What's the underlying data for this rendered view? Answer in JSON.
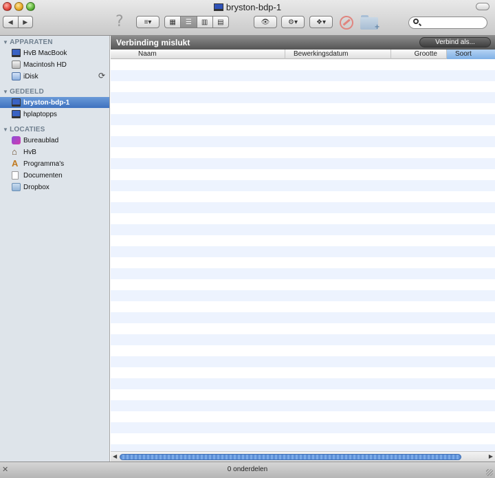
{
  "window": {
    "title": "bryston-bdp-1"
  },
  "toolbar": {
    "back_glyph": "◀",
    "forward_glyph": "▶",
    "help_glyph": "?",
    "arrange_glyph": "≡▾",
    "view_icon_glyph": "▦",
    "view_list_glyph": "☰",
    "view_column_glyph": "▥",
    "view_coverflow_glyph": "▤",
    "quicklook_glyph": "👁",
    "action_glyph": "⚙▾",
    "dropbox_glyph": "❖▾",
    "search_placeholder": ""
  },
  "sidebar": {
    "sections": [
      {
        "title": "APPARATEN"
      },
      {
        "title": "GEDEELD"
      },
      {
        "title": "LOCATIES"
      }
    ],
    "devices": [
      {
        "label": "HvB MacBook",
        "icon": "laptop-icon"
      },
      {
        "label": "Macintosh HD",
        "icon": "hard-disk-icon"
      },
      {
        "label": "iDisk",
        "icon": "idisk-icon",
        "sync_glyph": "⟳"
      }
    ],
    "shared": [
      {
        "label": "bryston-bdp-1",
        "icon": "network-computer-icon",
        "selected": true
      },
      {
        "label": "hplaptopps",
        "icon": "network-computer-icon",
        "selected": false
      }
    ],
    "places": [
      {
        "label": "Bureaublad",
        "icon": "desktop-icon"
      },
      {
        "label": "HvB",
        "icon": "home-icon"
      },
      {
        "label": "Programma's",
        "icon": "applications-icon"
      },
      {
        "label": "Documenten",
        "icon": "documents-icon"
      },
      {
        "label": "Dropbox",
        "icon": "dropbox-folder-icon"
      }
    ]
  },
  "main": {
    "banner": {
      "message": "Verbinding mislukt",
      "button_label": "Verbind als..."
    },
    "columns": [
      {
        "label": "Naam"
      },
      {
        "label": "Bewerkingsdatum"
      },
      {
        "label": "Grootte"
      },
      {
        "label": "Soort",
        "sorted": true
      }
    ],
    "rows": []
  },
  "status": {
    "item_count": "0 onderdelen"
  },
  "colors": {
    "selection": "#3f72bf",
    "sidebar_bg": "#dee4ea",
    "banner_bg": "#555555",
    "row_stripe": "#edf3fe"
  }
}
